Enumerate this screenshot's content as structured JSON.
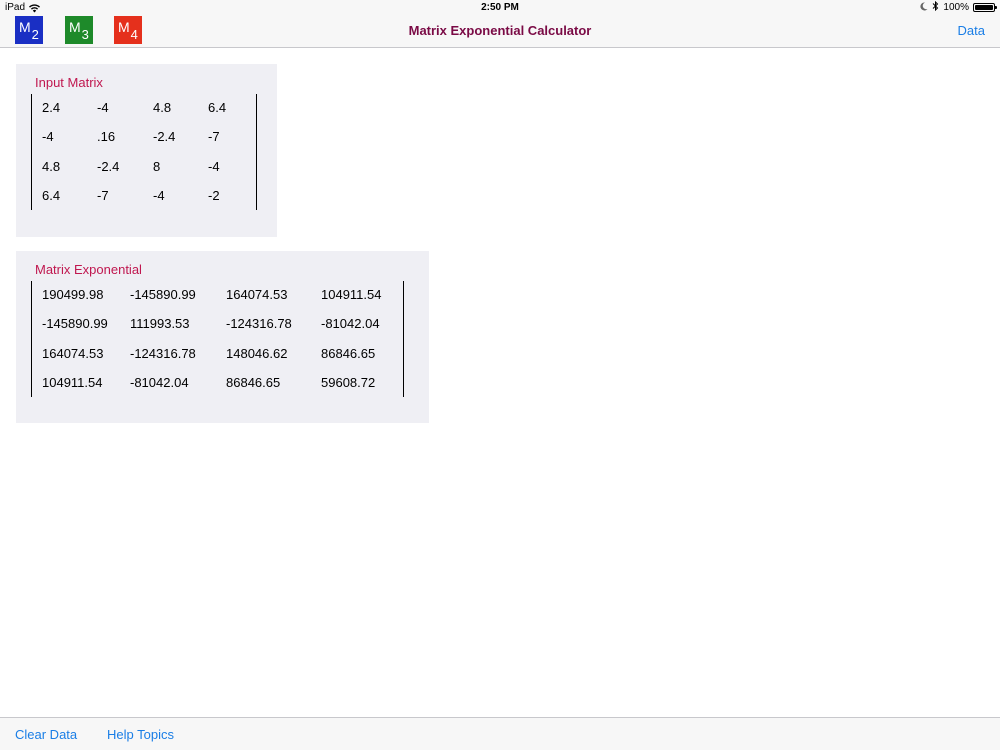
{
  "status": {
    "device": "iPad",
    "time": "2:50 PM",
    "battery": "100%"
  },
  "navbar": {
    "buttons": [
      {
        "main": "M",
        "sub": "2",
        "color": "#1a2fc4"
      },
      {
        "main": "M",
        "sub": "3",
        "color": "#1e8a2a"
      },
      {
        "main": "M",
        "sub": "4",
        "color": "#e5301c"
      }
    ],
    "title": "Matrix Exponential Calculator",
    "data_label": "Data"
  },
  "colors": {
    "title": "#7a0a45",
    "panel_title": "#c0174f",
    "link": "#1a7ee6"
  },
  "input_matrix": {
    "title": "Input Matrix",
    "rows": [
      [
        "2.4",
        "-4",
        "4.8",
        "6.4"
      ],
      [
        "-4",
        ".16",
        "-2.4",
        "-7"
      ],
      [
        "4.8",
        "-2.4",
        "8",
        "-4"
      ],
      [
        "6.4",
        "-7",
        "-4",
        "-2"
      ]
    ]
  },
  "matrix_exponential": {
    "title": "Matrix Exponential",
    "rows": [
      [
        "190499.98",
        "-145890.99",
        "164074.53",
        "104911.54"
      ],
      [
        "-145890.99",
        "111993.53",
        "-124316.78",
        "-81042.04"
      ],
      [
        "164074.53",
        "-124316.78",
        "148046.62",
        "86846.65"
      ],
      [
        "104911.54",
        "-81042.04",
        "86846.65",
        "59608.72"
      ]
    ]
  },
  "toolbar": {
    "clear_label": "Clear Data",
    "help_label": "Help Topics"
  }
}
